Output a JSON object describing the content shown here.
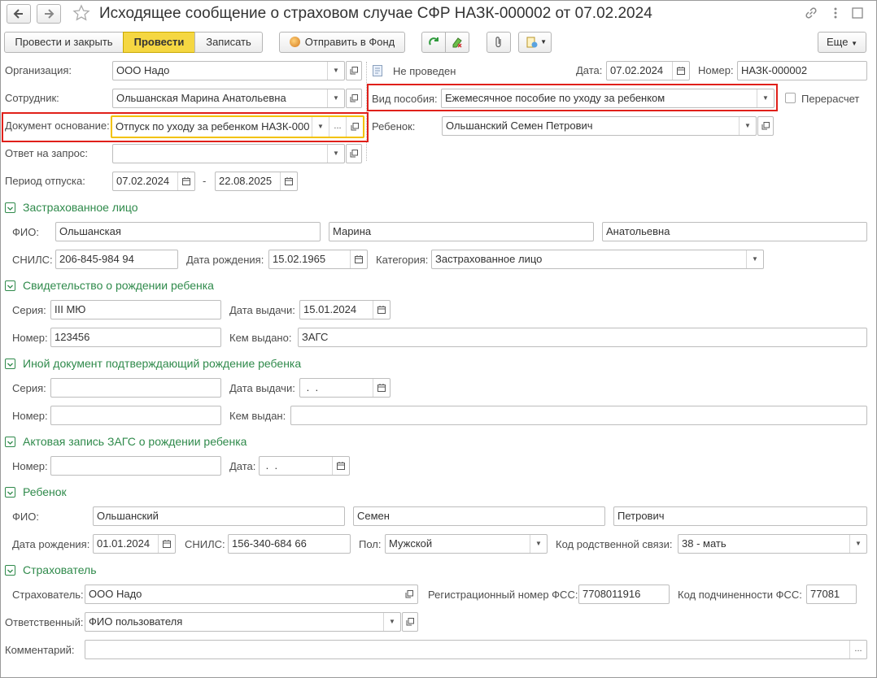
{
  "window": {
    "title": "Исходящее сообщение о страховом случае СФР НАЗК-000002 от 07.02.2024"
  },
  "toolbar": {
    "post_close": "Провести и закрыть",
    "post": "Провести",
    "save": "Записать",
    "send": "Отправить в Фонд",
    "more": "Еще"
  },
  "header": {
    "org_label": "Организация:",
    "org_value": "ООО Надо",
    "status_text": "Не проведен",
    "date_label": "Дата:",
    "date_value": "07.02.2024",
    "number_label": "Номер:",
    "number_value": "НАЗК-000002",
    "employee_label": "Сотрудник:",
    "employee_value": "Ольшанская Марина Анатольевна",
    "benefit_label": "Вид пособия:",
    "benefit_value": "Ежемесячное пособие по уходу за ребенком",
    "recalc_label": "Перерасчет",
    "basis_label": "Документ основание:",
    "basis_value": "Отпуск по уходу за ребенком НАЗК-000",
    "child_label": "Ребенок:",
    "child_value": "Ольшанский Семен Петрович",
    "answer_label": "Ответ на запрос:",
    "answer_value": "",
    "period_label": "Период отпуска:",
    "period_from": "07.02.2024",
    "period_dash": "-",
    "period_to": "22.08.2025"
  },
  "insured": {
    "title": "Застрахованное лицо",
    "fio_label": "ФИО:",
    "last": "Ольшанская",
    "first": "Марина",
    "middle": "Анатольевна",
    "snils_label": "СНИЛС:",
    "snils": "206-845-984 94",
    "birth_label": "Дата рождения:",
    "birth": "15.02.1965",
    "cat_label": "Категория:",
    "cat": "Застрахованное лицо"
  },
  "cert": {
    "title": "Свидетельство о рождении ребенка",
    "series_label": "Серия:",
    "series": "III МЮ",
    "issue_label": "Дата выдачи:",
    "issue": "15.01.2024",
    "num_label": "Номер:",
    "num": "123456",
    "by_label": "Кем выдано:",
    "by": "ЗАГС"
  },
  "other": {
    "title": "Иной документ подтверждающий рождение ребенка",
    "series_label": "Серия:",
    "series": "",
    "issue_label": "Дата выдачи:",
    "issue": " .  .",
    "num_label": "Номер:",
    "num": "",
    "by_label": "Кем выдан:",
    "by": ""
  },
  "act": {
    "title": "Актовая запись ЗАГС о рождении ребенка",
    "num_label": "Номер:",
    "num": "",
    "date_label": "Дата:",
    "date": " .  ."
  },
  "child": {
    "title": "Ребенок",
    "fio_label": "ФИО:",
    "last": "Ольшанский",
    "first": "Семен",
    "middle": "Петрович",
    "birth_label": "Дата рождения:",
    "birth": "01.01.2024",
    "snils_label": "СНИЛС:",
    "snils": "156-340-684 66",
    "sex_label": "Пол:",
    "sex": "Мужской",
    "rel_label": "Код родственной связи:",
    "rel": "38 - мать"
  },
  "insurer": {
    "title": "Страхователь",
    "ins_label": "Страхователь:",
    "ins": "ООО Надо",
    "reg_label": "Регистрационный номер ФСС:",
    "reg": "7708011916",
    "sub_label": "Код подчиненности ФСС:",
    "sub": "77081",
    "resp_label": "Ответственный:",
    "resp": "ФИО пользователя",
    "comment_label": "Комментарий:",
    "comment": ""
  },
  "colors": {
    "accent": "#2f8a4b",
    "post_button": "#f5d742",
    "highlight_red": "#e0201a",
    "focus_yellow": "#f2c200"
  }
}
